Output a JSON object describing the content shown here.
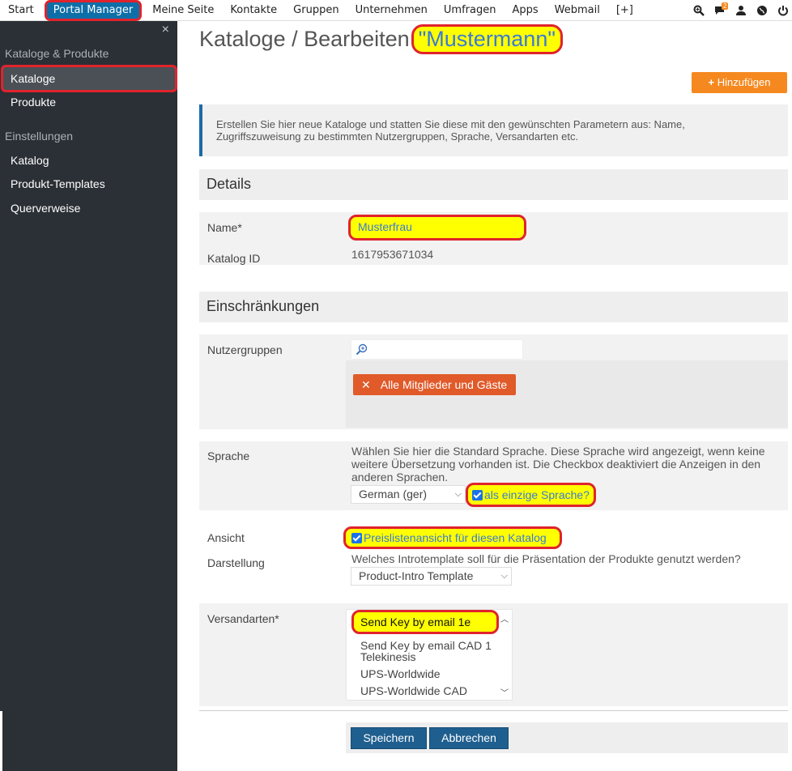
{
  "topnav": {
    "items": [
      "Start",
      "Portal Manager",
      "Meine Seite",
      "Kontakte",
      "Gruppen",
      "Unternehmen",
      "Umfragen",
      "Apps",
      "Webmail",
      "[+]"
    ],
    "notification_count": "2"
  },
  "sidebar": {
    "section1": "Kataloge & Produkte",
    "item_kataloge": "Kataloge",
    "item_produkte": "Produkte",
    "section2": "Einstellungen",
    "item_katalog": "Katalog",
    "item_templates": "Produkt-Templates",
    "item_querverweise": "Querverweise",
    "close": "×"
  },
  "page": {
    "title_prefix": "Kataloge / Bearbeiten",
    "title_name": "\"Mustermann\"",
    "add_button": "Hinzufügen",
    "info_line1": "Erstellen Sie hier neue Kataloge und statten Sie diese mit den gewünschten Parametern aus: Name,",
    "info_line2": "Zugriffszuweisung zu bestimmten Nutzergruppen, Sprache, Versandarten etc."
  },
  "details": {
    "heading": "Details",
    "name_label": "Name*",
    "name_value": "Musterfrau",
    "id_label": "Katalog ID",
    "id_value": "1617953671034"
  },
  "restrictions": {
    "heading": "Einschränkungen",
    "groups_label": "Nutzergruppen",
    "chip": "Alle Mitglieder und Gäste",
    "language_label": "Sprache",
    "language_help1": "Wählen Sie hier die Standard Sprache. Diese Sprache wird angezeigt, wenn keine",
    "language_help2": "weitere Übersetzung vorhanden ist. Die Checkbox deaktiviert die Anzeigen in den",
    "language_help3": "anderen Sprachen.",
    "language_select": "German (ger)",
    "only_language": "als einzige Sprache?",
    "view_label": "Ansicht",
    "price_list": "Preislistenansicht für diesen Katalog",
    "display_label": "Darstellung",
    "display_help": "Welches Introtemplate soll für die Präsentation der Produkte genutzt werden?",
    "display_select": "Product-Intro Template",
    "shipping_label": "Versandarten*",
    "shipping_options": [
      "Send Key by email 1e",
      "Send Key by email CAD 1",
      "Telekinesis",
      "UPS-Worldwide",
      "UPS-Worldwide CAD"
    ]
  },
  "actions": {
    "save": "Speichern",
    "cancel": "Abbrechen"
  },
  "colors": {
    "sidebar_bg": "#2b3036",
    "accent_orange": "#f5891f",
    "primary_blue": "#1f5f8f",
    "highlight_yellow": "#ffff00",
    "annotation_red": "#e0232c"
  }
}
